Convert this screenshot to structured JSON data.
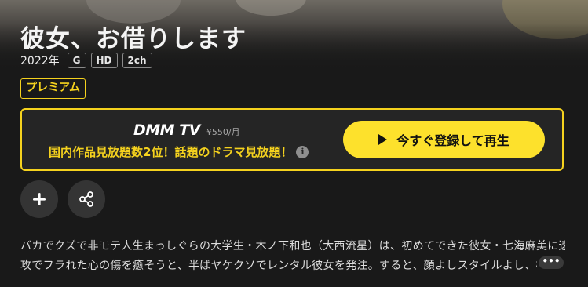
{
  "header": {
    "title": "彼女、お借りします",
    "year": "2022年",
    "tags": [
      "G",
      "HD",
      "2ch"
    ]
  },
  "badge": {
    "label": "プレミアム"
  },
  "promo": {
    "brand": "DMM TV",
    "price": "¥550/月",
    "copy": "国内作品見放題数2位！話題のドラマ見放題！",
    "info_icon": "info-icon",
    "cta_label": "今すぐ登録して再生",
    "cta_icon": "play-icon"
  },
  "actions": [
    {
      "name": "add-to-list",
      "icon": "plus-icon"
    },
    {
      "name": "share",
      "icon": "share-icon"
    }
  ],
  "synopsis": {
    "line1": "バカでクズで非モテ人生まっしぐらの大学生・木ノ下和也（大西流星）は、初めてできた彼女・七海麻美に速",
    "line2": "攻でフラれた心の傷を癒そうと、半ばヤケクソでレンタル彼女を発注。すると、顔よしスタイルよし、機",
    "more_label": "•••"
  },
  "colors": {
    "accent": "#f5d21e",
    "cta_bg": "#fde12c",
    "background": "#191919",
    "panel": "#252525"
  }
}
